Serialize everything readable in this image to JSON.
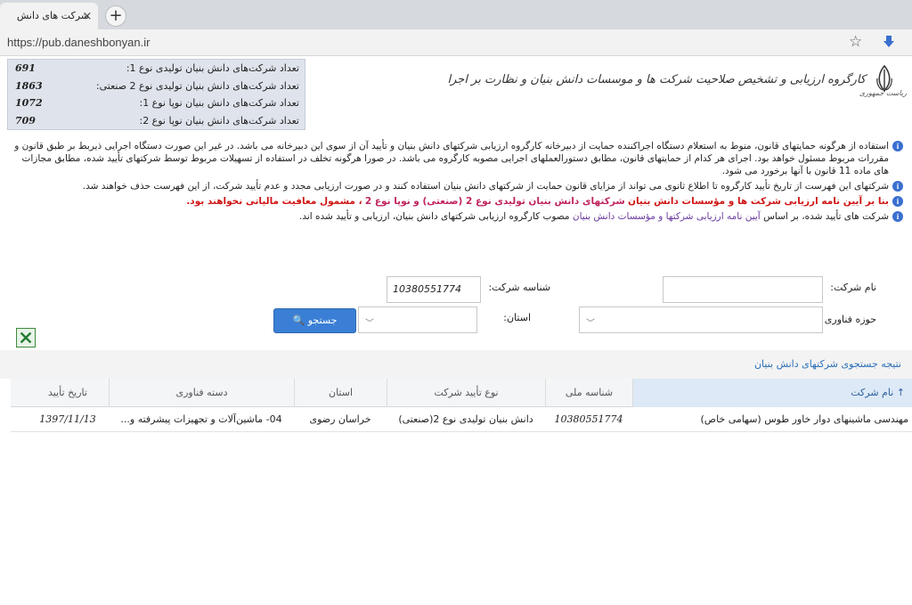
{
  "browser": {
    "tab_title": "شرکت های دانش بنیان",
    "tab_close": "×",
    "new_tab": "+",
    "url": "https://pub.daneshbonyan.ir"
  },
  "stats": [
    {
      "label": "تعداد شرکت‌های دانش بنیان تولیدی نوع 1:",
      "value": "691"
    },
    {
      "label": "تعداد شرکت‌های دانش بنیان تولیدی نوع 2 صنعتی:",
      "value": "1863"
    },
    {
      "label": "تعداد شرکت‌های دانش بنیان نوپا نوع 1:",
      "value": "1072"
    },
    {
      "label": "تعداد شرکت‌های دانش بنیان نوپا نوع 2:",
      "value": "709"
    }
  ],
  "header": {
    "org_title": "کارگروه ارزیابی و تشخیص صلاحیت شرکت ها و موسسات دانش بنیان و نظارت بر اجرا",
    "emblem_caption": "ریاست جمهوری"
  },
  "notices": {
    "n1": "استفاده از هرگونه حمایتهای قانون، منوط به استعلام دستگاه اجراکننده حمایت از دبیرخانه کارگروه ارزیابی شرکتهای دانش بنیان و تأیید آن از سوی این دبیرخانه می باشد. در غیر این صورت دستگاه اجرایی ذیربط بر طبق قانون و مقررات مربوط مسئول خواهد بود. اجرای هر کدام از حمایتهای قانون، مطابق دستورالعملهای اجرایی مصوبه کارگروه می باشد. در صورا هرگونه تخلف در استفاده از تسهیلات مربوط توسط شرکتهای تأیید شده، مطابق مجازات های ماده 11 قانون با آنها برخورد می شود.",
    "n2": "شرکتهای این فهرست از تاریخ تأیید کارگروه تا اطلاع ثانوی می تواند از مزایای قانون حمایت از شرکتهای دانش بنیان استفاده کنند و در صورت ارزیابی مجدد و عدم تأیید شرکت، از این فهرست حذف خواهند شد.",
    "n3_part1": "بنا بر آیین نامه ارزیابی شرکت ها و مؤسسات دانش بنیان",
    "n3_link": "شرکتهای دانش بنیان تولیدی نوع 2 (صنعتی) و نوپا نوع 2",
    "n3_part2": "، مشمول معافیت مالیاتی نخواهند بود.",
    "n4_part1": "شرکت های تأیید شده، بر اساس",
    "n4_link": "آیین نامه ارزیابی شرکتها و مؤسسات دانش بنیان",
    "n4_part2": "مصوب کارگروه ارزیابی شرکتهای دانش بنیان، ارزیابی و تأیید شده اند.",
    "info_glyph": "i"
  },
  "form": {
    "company_name_label": "نام شرکت:",
    "company_name_value": "",
    "company_id_label": "شناسه شرکت:",
    "company_id_value": "10380551774",
    "tech_field_label": "حوزه فناوری",
    "tech_field_value": "",
    "province_label": "استان:",
    "province_value": "",
    "search_button": "جستجو",
    "search_icon": "magnifier-icon",
    "excel_icon": "excel-icon"
  },
  "results": {
    "title": "نتیجه جستجوی شرکتهای دانش بنیان",
    "columns": [
      "نام شرکت",
      "شناسه ملی",
      "نوع تأیید شرکت",
      "استان",
      "دسته فناوری",
      "تاریخ تأیید"
    ],
    "sort_indicator": "↑",
    "rows": [
      [
        "مهندسی ماشینهای دوار خاور طوس (سهامی خاص)",
        "10380551774",
        "دانش بنیان تولیدی نوع 2(صنعتی)",
        "خراسان رضوی",
        "04- ماشین‌آلات و تجهیزات پیشرفته و...",
        "1397/11/13"
      ]
    ]
  },
  "colors": {
    "accent": "#3a7fd5",
    "stats_bg": "#dfe4ec",
    "notice_red": "#d01515",
    "link": "#6a3aa0"
  }
}
